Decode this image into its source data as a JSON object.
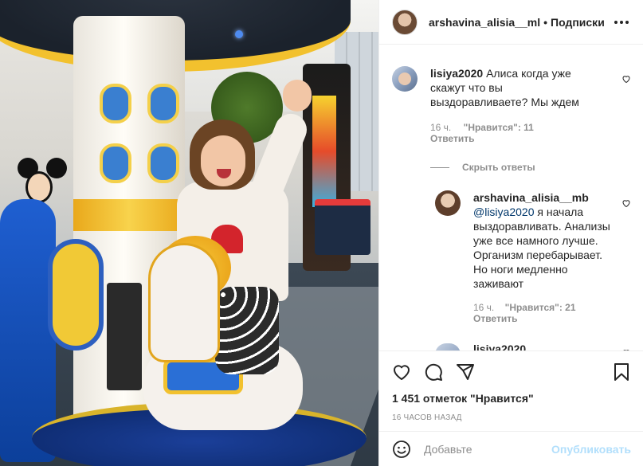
{
  "post": {
    "author": {
      "username": "arshavina_alisia__ml",
      "separator": "•",
      "follow_label": "Подписки"
    },
    "photo_description_icon": "photo"
  },
  "comments": [
    {
      "username": "lisiya2020",
      "text": "Алиса когда уже скажут что вы выздоравливаете? Мы ждем",
      "time": "16 ч.",
      "likes_label": "\"Нравится\": 11",
      "reply_label": "Ответить",
      "hide_replies_label": "Скрыть ответы",
      "replies": [
        {
          "username": "arshavina_alisia__mb",
          "mention": "@lisiya2020",
          "text": "я начала выздоравливать. Анализы уже все намного лучше. Организм перебарывает. Но ноги медленно заживают",
          "time": "16 ч.",
          "likes_label": "\"Нравится\": 21",
          "reply_label": "Ответить"
        },
        {
          "username": "lisiya2020"
        }
      ]
    }
  ],
  "actions": {
    "icons": [
      "heart-icon",
      "comment-icon",
      "share-icon",
      "bookmark-icon"
    ],
    "likes_count": "1 451 отметок \"Нравится\"",
    "time_ago": "16 ЧАСОВ НАЗАД"
  },
  "add_comment": {
    "placeholder": "Добавьте",
    "publish_label": "Опубликовать",
    "publish_color": "#b2dffc"
  },
  "colors": {
    "text": "#262626",
    "secondary": "#8e8e8e",
    "border": "#efefef",
    "mention": "#00376b"
  }
}
